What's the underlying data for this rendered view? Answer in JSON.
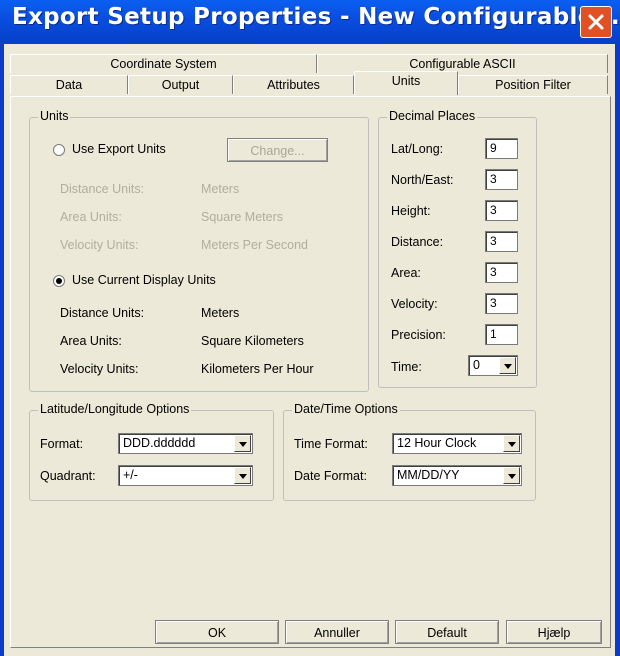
{
  "window": {
    "title": "Export Setup Properties - New Configurable ..."
  },
  "tabs": {
    "row1": [
      {
        "label": "Coordinate System"
      },
      {
        "label": "Configurable ASCII"
      }
    ],
    "row2": [
      {
        "label": "Data"
      },
      {
        "label": "Output"
      },
      {
        "label": "Attributes"
      },
      {
        "label": "Units",
        "active": true
      },
      {
        "label": "Position Filter"
      }
    ]
  },
  "units": {
    "legend": "Units",
    "export_option": "Use Export Units",
    "change_button": "Change...",
    "export_rows": [
      {
        "label": "Distance Units:",
        "value": "Meters"
      },
      {
        "label": "Area Units:",
        "value": "Square Meters"
      },
      {
        "label": "Velocity Units:",
        "value": "Meters Per Second"
      }
    ],
    "display_option": "Use Current Display Units",
    "selected": "display",
    "display_rows": [
      {
        "label": "Distance Units:",
        "value": "Meters"
      },
      {
        "label": "Area Units:",
        "value": "Square Kilometers"
      },
      {
        "label": "Velocity Units:",
        "value": "Kilometers Per Hour"
      }
    ]
  },
  "decimal_places": {
    "legend": "Decimal Places",
    "fields": [
      {
        "label": "Lat/Long:",
        "value": "9"
      },
      {
        "label": "North/East:",
        "value": "3"
      },
      {
        "label": "Height:",
        "value": "3"
      },
      {
        "label": "Distance:",
        "value": "3"
      },
      {
        "label": "Area:",
        "value": "3"
      },
      {
        "label": "Velocity:",
        "value": "3"
      },
      {
        "label": "Precision:",
        "value": "1"
      }
    ],
    "time_label": "Time:",
    "time_value": "0"
  },
  "latlong": {
    "legend": "Latitude/Longitude Options",
    "format_label": "Format:",
    "format_value": "DDD.dddddd",
    "quadrant_label": "Quadrant:",
    "quadrant_value": "+/-"
  },
  "datetime": {
    "legend": "Date/Time Options",
    "time_format_label": "Time Format:",
    "time_format_value": "12 Hour Clock",
    "date_format_label": "Date Format:",
    "date_format_value": "MM/DD/YY"
  },
  "buttons": {
    "ok": "OK",
    "cancel": "Annuller",
    "default": "Default",
    "help": "Hjælp"
  },
  "colors": {
    "titlebar": "#0a4ee0",
    "close": "#e05226",
    "face": "#ece9d8",
    "disabled_text": "#b0ae9f"
  }
}
